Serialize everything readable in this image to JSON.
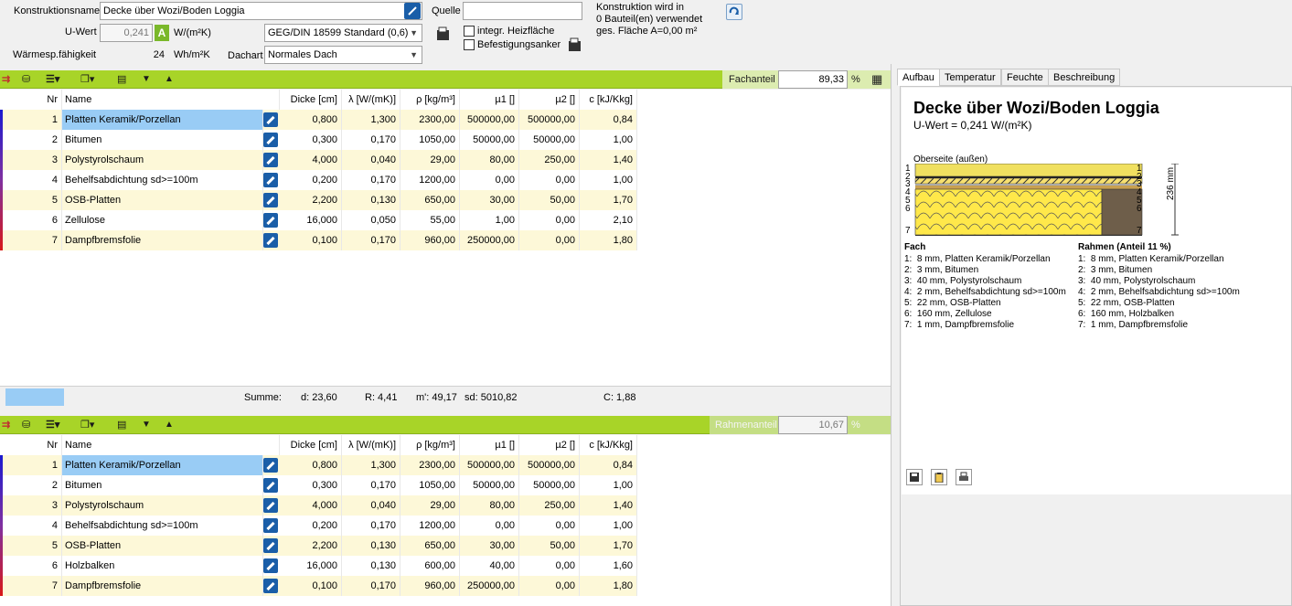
{
  "header": {
    "konstruktionsname_label": "Konstruktionsname",
    "konstruktionsname_value": "Decke über Wozi/Boden Loggia",
    "quelle_label": "Quelle",
    "quelle_value": "",
    "info_line1": "Konstruktion wird in",
    "info_line2": "0 Bauteil(en) verwendet",
    "info_line3": "ges. Fläche A=0,00 m²",
    "uwert_label": "U-Wert",
    "uwert_value": "0,241",
    "uwert_badge": "A",
    "uwert_unit": "W/(m²K)",
    "norm_select": "GEG/DIN 18599 Standard (0,6)",
    "integr_label": "integr. Heizfläche",
    "befestigung_label": "Befestigungsanker",
    "waerme_label": "Wärmesp.fähigkeit",
    "waerme_value": "24",
    "waerme_unit": "Wh/m²K",
    "dachart_label": "Dachart",
    "dachart_select": "Normales Dach"
  },
  "fach": {
    "anteil_label": "Fachanteil",
    "anteil_value": "89,33",
    "anteil_unit": "%",
    "columns": [
      "Nr",
      "Name",
      "Dicke [cm]",
      "λ [W/(mK)]",
      "ρ [kg/m³]",
      "µ1 []",
      "µ2 []",
      "c [kJ/Kkg]"
    ],
    "rows": [
      {
        "nr": "1",
        "name": "Platten Keramik/Porzellan",
        "dicke": "0,800",
        "lambda": "1,300",
        "rho": "2300,00",
        "mu1": "500000,00",
        "mu2": "500000,00",
        "c": "0,84"
      },
      {
        "nr": "2",
        "name": "Bitumen",
        "dicke": "0,300",
        "lambda": "0,170",
        "rho": "1050,00",
        "mu1": "50000,00",
        "mu2": "50000,00",
        "c": "1,00"
      },
      {
        "nr": "3",
        "name": "Polystyrolschaum",
        "dicke": "4,000",
        "lambda": "0,040",
        "rho": "29,00",
        "mu1": "80,00",
        "mu2": "250,00",
        "c": "1,40"
      },
      {
        "nr": "4",
        "name": "Behelfsabdichtung sd>=100m",
        "dicke": "0,200",
        "lambda": "0,170",
        "rho": "1200,00",
        "mu1": "0,00",
        "mu2": "0,00",
        "c": "1,00"
      },
      {
        "nr": "5",
        "name": "OSB-Platten",
        "dicke": "2,200",
        "lambda": "0,130",
        "rho": "650,00",
        "mu1": "30,00",
        "mu2": "50,00",
        "c": "1,70"
      },
      {
        "nr": "6",
        "name": "Zellulose",
        "dicke": "16,000",
        "lambda": "0,050",
        "rho": "55,00",
        "mu1": "1,00",
        "mu2": "0,00",
        "c": "2,10"
      },
      {
        "nr": "7",
        "name": "Dampfbremsfolie",
        "dicke": "0,100",
        "lambda": "0,170",
        "rho": "960,00",
        "mu1": "250000,00",
        "mu2": "0,00",
        "c": "1,80"
      }
    ],
    "summe_label": "Summe:",
    "sum_d": "d: 23,60",
    "sum_r": "R: 4,41",
    "sum_m": "m': 49,17",
    "sum_sd": "sd: 5010,82",
    "sum_c": "C: 1,88"
  },
  "rahmen": {
    "anteil_label": "Rahmenanteil",
    "anteil_value": "10,67",
    "anteil_unit": "%",
    "rows": [
      {
        "nr": "1",
        "name": "Platten Keramik/Porzellan",
        "dicke": "0,800",
        "lambda": "1,300",
        "rho": "2300,00",
        "mu1": "500000,00",
        "mu2": "500000,00",
        "c": "0,84"
      },
      {
        "nr": "2",
        "name": "Bitumen",
        "dicke": "0,300",
        "lambda": "0,170",
        "rho": "1050,00",
        "mu1": "50000,00",
        "mu2": "50000,00",
        "c": "1,00"
      },
      {
        "nr": "3",
        "name": "Polystyrolschaum",
        "dicke": "4,000",
        "lambda": "0,040",
        "rho": "29,00",
        "mu1": "80,00",
        "mu2": "250,00",
        "c": "1,40"
      },
      {
        "nr": "4",
        "name": "Behelfsabdichtung sd>=100m",
        "dicke": "0,200",
        "lambda": "0,170",
        "rho": "1200,00",
        "mu1": "0,00",
        "mu2": "0,00",
        "c": "1,00"
      },
      {
        "nr": "5",
        "name": "OSB-Platten",
        "dicke": "2,200",
        "lambda": "0,130",
        "rho": "650,00",
        "mu1": "30,00",
        "mu2": "50,00",
        "c": "1,70"
      },
      {
        "nr": "6",
        "name": "Holzbalken",
        "dicke": "16,000",
        "lambda": "0,130",
        "rho": "600,00",
        "mu1": "40,00",
        "mu2": "0,00",
        "c": "1,60"
      },
      {
        "nr": "7",
        "name": "Dampfbremsfolie",
        "dicke": "0,100",
        "lambda": "0,170",
        "rho": "960,00",
        "mu1": "250000,00",
        "mu2": "0,00",
        "c": "1,80"
      }
    ]
  },
  "right": {
    "tabs": [
      "Aufbau",
      "Temperatur",
      "Feuchte",
      "Beschreibung"
    ],
    "title": "Decke über Wozi/Boden Loggia",
    "uwert": "U-Wert = 0,241 W/(m²K)",
    "oberseite": "Oberseite (außen)",
    "dim_label": "236 mm",
    "layer_numbers": [
      "1",
      "2",
      "3",
      "4",
      "5",
      "6",
      "7"
    ],
    "fach_title": "Fach",
    "rahmen_title": "Rahmen (Anteil 11 %)",
    "fach_legend": [
      "1:  8 mm, Platten Keramik/Porzellan",
      "2:  3 mm, Bitumen",
      "3:  40 mm, Polystyrolschaum",
      "4:  2 mm, Behelfsabdichtung sd>=100m",
      "5:  22 mm, OSB-Platten",
      "6:  160 mm, Zellulose",
      "7:  1 mm, Dampfbremsfolie"
    ],
    "rahmen_legend": [
      "1:  8 mm, Platten Keramik/Porzellan",
      "2:  3 mm, Bitumen",
      "3:  40 mm, Polystyrolschaum",
      "4:  2 mm, Behelfsabdichtung sd>=100m",
      "5:  22 mm, OSB-Platten",
      "6:  160 mm, Holzbalken",
      "7:  1 mm, Dampfbremsfolie"
    ]
  },
  "colors": {
    "toolbar": "#a8d428",
    "row_alt": "#fdf8d8",
    "selected": "#99ccf5",
    "accent_blue": "#1a5ea8"
  }
}
